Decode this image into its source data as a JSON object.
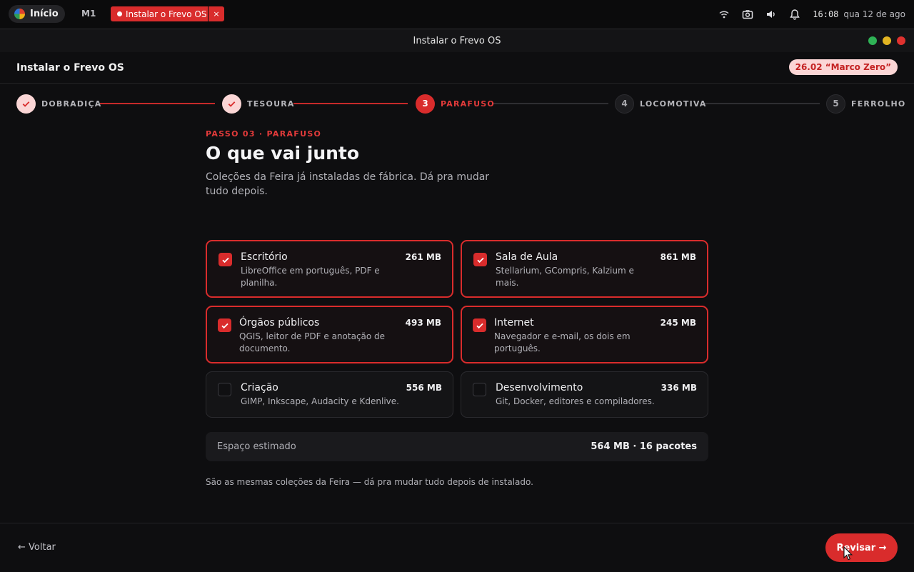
{
  "system_bar": {
    "start_label": "Início",
    "workspace_label": "M1",
    "task_label": "Instalar o Frevo OS",
    "task_close_glyph": "×",
    "tray_icons": [
      "wifi-icon",
      "camera-icon",
      "volume-icon",
      "bell-icon"
    ],
    "clock": "16:08",
    "date": "qua 12 de ago"
  },
  "window": {
    "title": "Instalar o Frevo OS"
  },
  "app": {
    "title": "Instalar o Frevo OS",
    "version_badge": "26.02 “Marco Zero”"
  },
  "stepper": {
    "steps": [
      {
        "number": "1",
        "label": "DOBRADIÇA",
        "state": "done"
      },
      {
        "number": "2",
        "label": "TESOURA",
        "state": "done"
      },
      {
        "number": "3",
        "label": "PARAFUSO",
        "state": "active"
      },
      {
        "number": "4",
        "label": "LOCOMOTIVA",
        "state": "todo"
      },
      {
        "number": "5",
        "label": "FERROLHO",
        "state": "todo"
      }
    ]
  },
  "page": {
    "eyebrow": "PASSO 03 · PARAFUSO",
    "heading": "O que vai junto",
    "subtext": "Coleções da Feira já instaladas de fábrica. Dá pra mudar tudo depois."
  },
  "collections": [
    {
      "title": "Escritório",
      "description": "LibreOffice em português, PDF e planilha.",
      "size": "261 MB",
      "checked": true
    },
    {
      "title": "Sala de Aula",
      "description": "Stellarium, GCompris, Kalzium e mais.",
      "size": "861 MB",
      "checked": true
    },
    {
      "title": "Órgãos públicos",
      "description": "QGIS, leitor de PDF e anotação de documento.",
      "size": "493 MB",
      "checked": true
    },
    {
      "title": "Internet",
      "description": "Navegador e e-mail, os dois em português.",
      "size": "245 MB",
      "checked": true
    },
    {
      "title": "Criação",
      "description": "GIMP, Inkscape, Audacity e Kdenlive.",
      "size": "556 MB",
      "checked": false
    },
    {
      "title": "Desenvolvimento",
      "description": "Git, Docker, editores e compiladores.",
      "size": "336 MB",
      "checked": false
    }
  ],
  "summary": {
    "label": "Espaço estimado",
    "value": "564 MB · 16 pacotes"
  },
  "footnote": "São as mesmas coleções da Feira — dá pra mudar tudo depois de instalado.",
  "footer": {
    "back_label": "← Voltar",
    "next_label": "Revisar →"
  },
  "colors": {
    "accent": "#d92c2c",
    "accent_soft": "#fbd6d6",
    "background": "#0e0e10"
  }
}
